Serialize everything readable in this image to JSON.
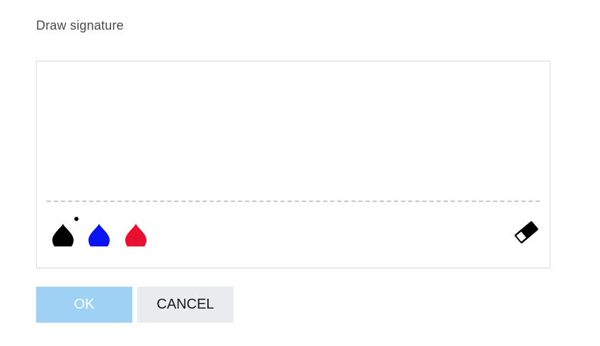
{
  "dialog": {
    "title": "Draw signature"
  },
  "pen_colors": [
    {
      "name": "black",
      "color": "#000000",
      "selected": true
    },
    {
      "name": "blue",
      "color": "#0a14f0",
      "selected": false
    },
    {
      "name": "red",
      "color": "#e8102e",
      "selected": false
    }
  ],
  "tools": {
    "eraser_icon": "eraser-icon"
  },
  "buttons": {
    "ok_label": "OK",
    "cancel_label": "CANCEL"
  },
  "colors": {
    "ok_bg": "#9fd1f5",
    "cancel_bg": "#e9ecee",
    "border": "#d6dcdc",
    "baseline": "#c8c8c8"
  }
}
